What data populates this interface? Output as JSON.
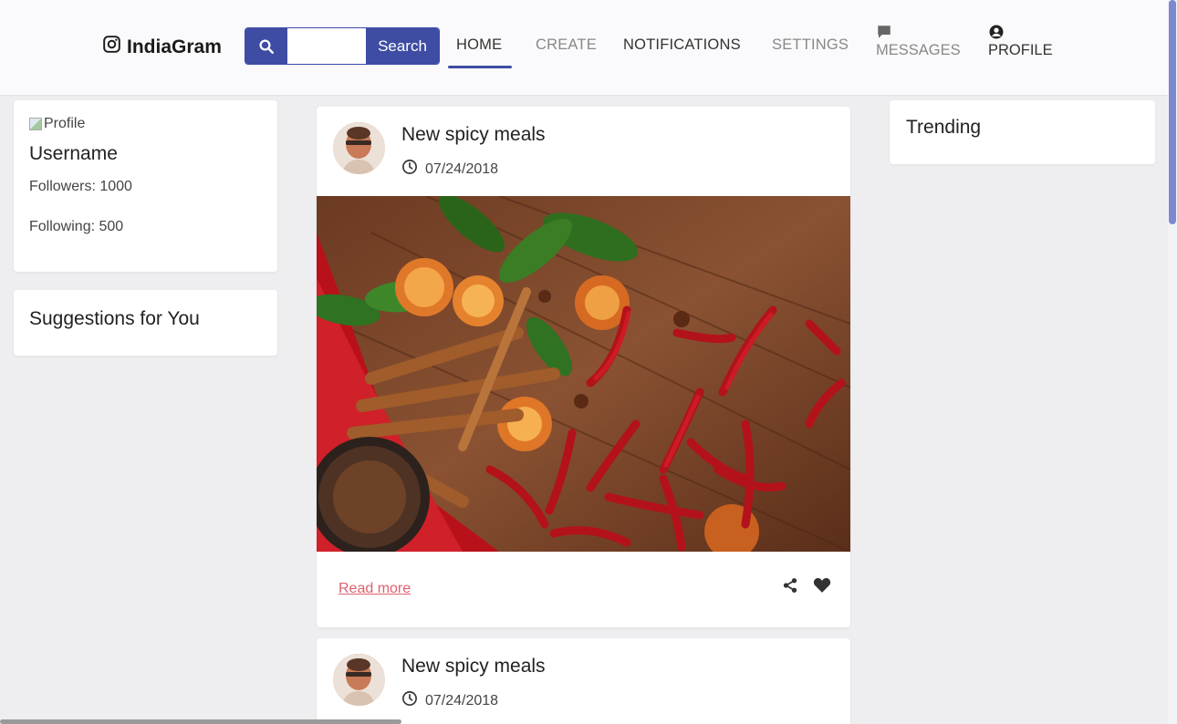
{
  "brand": {
    "name": "IndiaGram",
    "icon": "instagram-icon"
  },
  "search": {
    "placeholder": "",
    "value": "",
    "button_label": "Search",
    "icon": "search-icon"
  },
  "nav": {
    "home": "HOME",
    "create": "CREATE",
    "notifications": "NOTIFICATIONS",
    "settings": "SETTINGS",
    "messages": "MESSAGES",
    "profile": "PROFILE"
  },
  "profile_card": {
    "image_alt": "Profile",
    "username": "Username",
    "followers": "Followers: 1000",
    "following": "Following: 500"
  },
  "suggestions": {
    "title": "Suggestions for You"
  },
  "trending": {
    "title": "Trending"
  },
  "posts": [
    {
      "title": "New spicy meals",
      "date": "07/24/2018",
      "read_more": "Read more"
    },
    {
      "title": "New spicy meals",
      "date": "07/24/2018"
    }
  ],
  "colors": {
    "accent": "#3e4da3",
    "link": "#e0606e",
    "background": "#eeeef0"
  }
}
